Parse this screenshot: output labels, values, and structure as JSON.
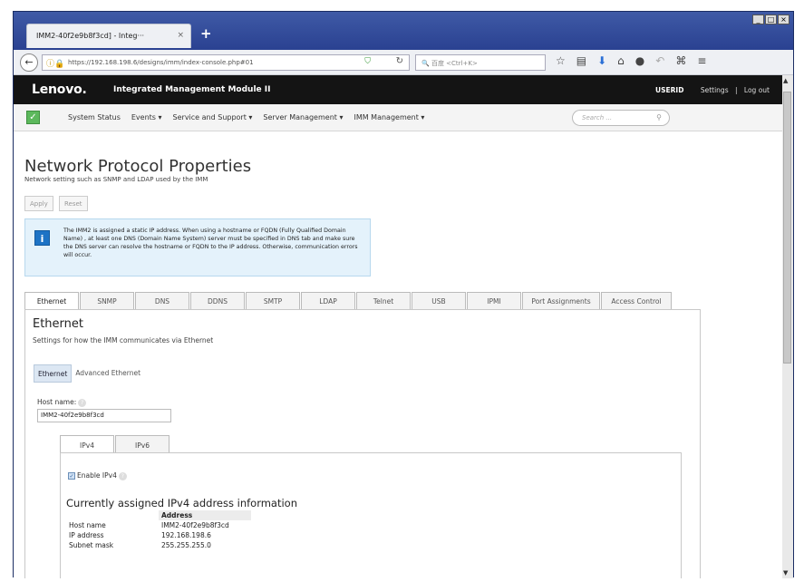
{
  "browser": {
    "tab_title": "IMM2-40f2e9b8f3cd] - Integ···",
    "tab_close": "×",
    "new_tab": "+",
    "url": "https://192.168.198.6/designs/imm/index-console.php#01",
    "search_placeholder": "百度 <Ctrl+K>",
    "win_min": "_",
    "win_max": "□",
    "win_close": "×"
  },
  "header": {
    "logo": "Lenovo.",
    "title": "Integrated Management Module II",
    "user": "USERID",
    "settings": "Settings",
    "separator": "|",
    "logout": "Log out"
  },
  "menu": {
    "items": [
      "System Status",
      "Events ▾",
      "Service and Support ▾",
      "Server Management ▾",
      "IMM Management ▾"
    ],
    "search_placeholder": "Search ..."
  },
  "page": {
    "title": "Network Protocol Properties",
    "subtitle": "Network setting such as SNMP and LDAP used by the IMM",
    "apply": "Apply",
    "reset": "Reset",
    "info": "The IMM2 is assigned a static IP address. When using a hostname or FQDN (Fully Qualified Domain Name) , at least one DNS (Domain Name System) server must be specified in DNS tab and make sure the DNS server can resolve the hostname or FQDN to the IP address. Otherwise, communication errors will occur."
  },
  "tabs": [
    "Ethernet",
    "SNMP",
    "DNS",
    "DDNS",
    "SMTP",
    "LDAP",
    "Telnet",
    "USB",
    "IPMI",
    "Port Assignments",
    "Access Control"
  ],
  "ethernet": {
    "title": "Ethernet",
    "subtitle": "Settings for how the IMM communicates via Ethernet",
    "subtab_active": "Ethernet",
    "subtab_other": "Advanced Ethernet",
    "host_label": "Host name:",
    "host_value": "IMM2-40f2e9b8f3cd",
    "ipv4_tab": "IPv4",
    "ipv6_tab": "IPv6",
    "enable_ipv4": "Enable IPv4",
    "assigned_title": "Currently assigned IPv4 address information",
    "table_header": "Address",
    "rows": [
      {
        "key": "Host name",
        "value": "IMM2-40f2e9b8f3cd"
      },
      {
        "key": "IP address",
        "value": "192.168.198.6"
      },
      {
        "key": "Subnet mask",
        "value": "255.255.255.0"
      }
    ]
  }
}
